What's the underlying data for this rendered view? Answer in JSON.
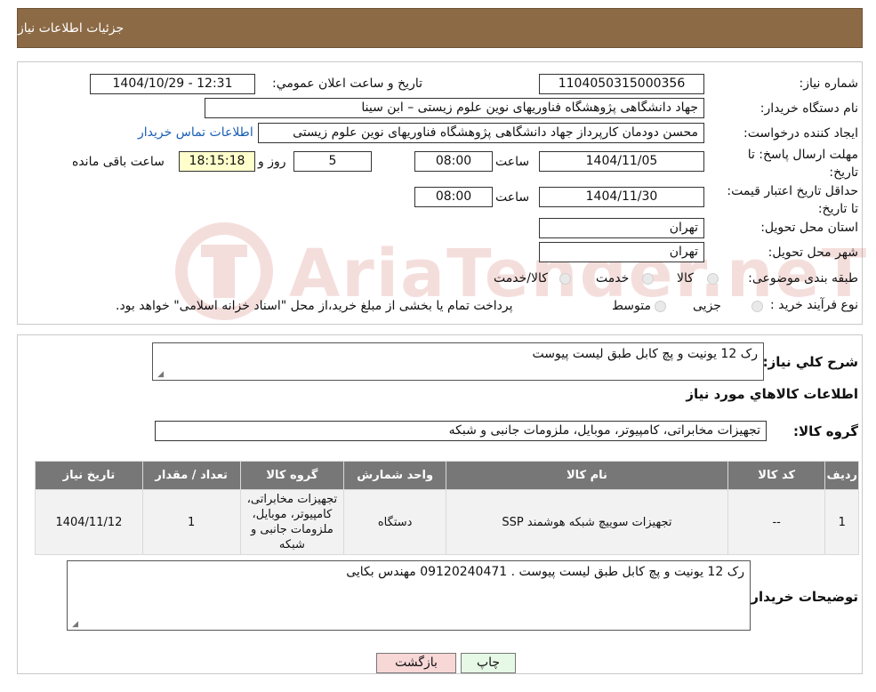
{
  "header": {
    "title": "جزئیات اطلاعات نیاز"
  },
  "form": {
    "need_number_label": "شماره نیاز:",
    "need_number": "1104050315000356",
    "announce_label": "تاریخ و ساعت اعلان عمومي:",
    "announce_value": "1404/10/29 - 12:31",
    "buyer_org_label": "نام دستگاه خریدار:",
    "buyer_org": "جهاد دانشگاهی پژوهشگاه فناوریهای نوین علوم زیستی – ابن سینا",
    "creator_label": "ایجاد کننده درخواست:",
    "creator": "محسن دودمان کارپرداز جهاد دانشگاهی پژوهشگاه فناوریهای نوین علوم زیستی",
    "contact_link": "اطلاعات تماس خریدار",
    "deadline_label": "مهلت ارسال پاسخ: تا تاریخ:",
    "deadline_date": "1404/11/05",
    "hour_label": "ساعت",
    "deadline_hour": "08:00",
    "days_value": "5",
    "days_label": "روز و",
    "remaining_time": "18:15:18",
    "remaining_label": "ساعت باقی مانده",
    "validity_label": "حداقل تاریخ اعتبار قیمت: تا تاریخ:",
    "validity_date": "1404/11/30",
    "validity_hour": "08:00",
    "province_label": "استان محل تحویل:",
    "province": "تهران",
    "city_label": "شهر محل تحویل:",
    "city": "تهران",
    "category_label": "طبقه بندی موضوعی:",
    "category_options": [
      "کالا",
      "خدمت",
      "کالا/خدمت"
    ],
    "process_label": "نوع فرآیند خرید :",
    "process_options": [
      "جزیی",
      "متوسط"
    ],
    "process_note": "پرداخت تمام یا بخشی از مبلغ خرید،از محل \"اسناد خزانه اسلامی\" خواهد بود."
  },
  "summary": {
    "label": "شرح کلي نياز:",
    "text": "رک 12 یونیت و پچ کابل طبق لیست پیوست"
  },
  "goods": {
    "section_title": "اطلاعات کالاهاي مورد نياز",
    "group_label": "گروه کالا:",
    "group_value": "تجهیزات مخابراتی، کامپیوتر، موبایل، ملزومات جانبی و شبکه",
    "columns": [
      "ردیف",
      "کد کالا",
      "نام کالا",
      "واحد شمارش",
      "گروه کالا",
      "تعداد / مقدار",
      "تاریخ نیاز"
    ],
    "rows": [
      [
        "1",
        "--",
        "تجهیزات سوییچ شبکه هوشمند SSP",
        "دستگاه",
        "تجهیزات مخابراتی، کامپیوتر، موبایل، ملزومات جانبی و شبکه",
        "1",
        "1404/11/12"
      ]
    ]
  },
  "notes": {
    "label": "توضیحات خریدار:",
    "text": "رک 12 یونیت و پچ کابل طبق لیست پیوست . 09120240471 مهندس بکایی"
  },
  "buttons": {
    "print": "چاپ",
    "back": "بازگشت"
  },
  "watermark": {
    "text": "AriaTender.neT"
  },
  "colors": {
    "header": "#8b6a45",
    "table_header": "#777777",
    "back_button": "#f8d7d7",
    "print_button": "#e6f9e6"
  }
}
